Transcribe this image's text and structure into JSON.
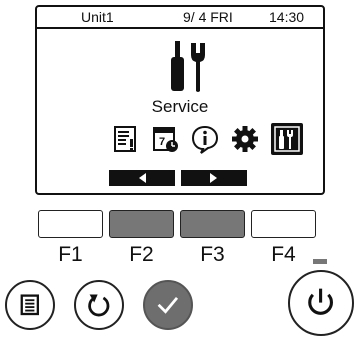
{
  "status": {
    "unit": "Unit1",
    "date": "9/ 4 FRI",
    "time": "14:30"
  },
  "screen": {
    "title": "Service",
    "menu_icons": [
      "report-icon",
      "calendar-icon",
      "info-icon",
      "settings-gear-icon",
      "service-tools-icon"
    ],
    "selected_icon": "service-tools-icon"
  },
  "nav": {
    "left_icon": "arrow-left-icon",
    "right_icon": "arrow-right-icon"
  },
  "function_keys": [
    {
      "label": "F1",
      "state": "normal"
    },
    {
      "label": "F2",
      "state": "active"
    },
    {
      "label": "F3",
      "state": "active"
    },
    {
      "label": "F4",
      "state": "normal"
    }
  ],
  "buttons": {
    "menu_icon": "menu-list-icon",
    "back_icon": "return-icon",
    "confirm_icon": "check-icon",
    "power_icon": "power-icon"
  },
  "colors": {
    "screen_fg": "#111111",
    "active_key": "#777777",
    "confirm_button": "#6e6e6e"
  }
}
